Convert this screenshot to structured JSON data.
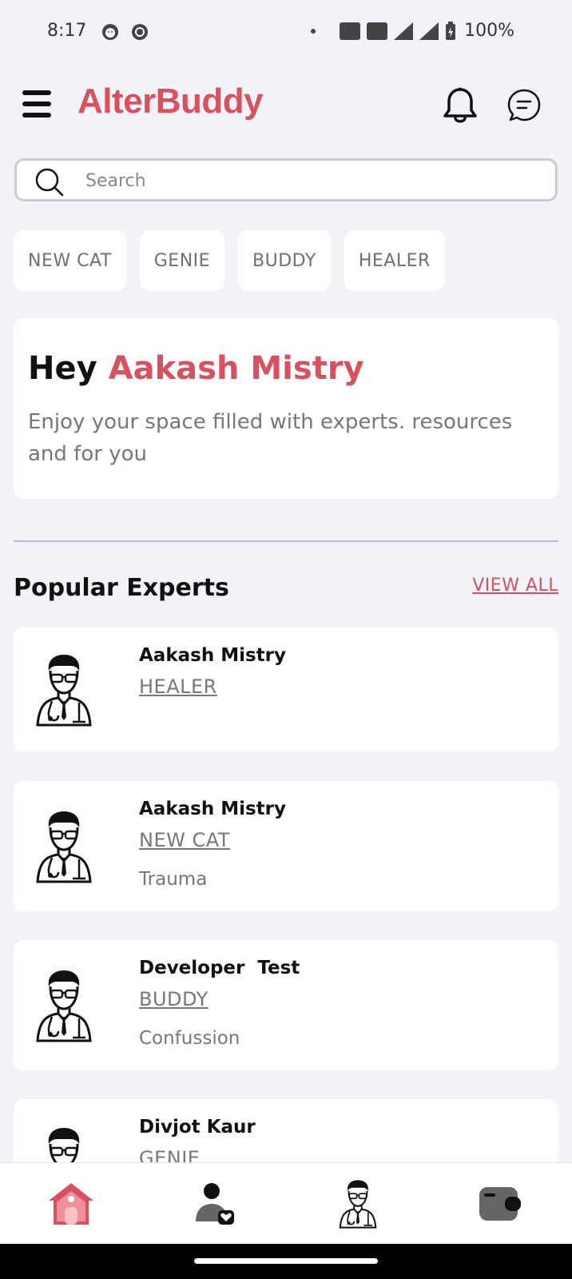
{
  "status_bar": {
    "time": "8:17",
    "battery": "100%"
  },
  "header": {
    "logo_text": "AlterBuddy",
    "menu_icon": "hamburger-icon",
    "bell_icon": "bell-icon",
    "chat_icon": "chat-bubble-icon"
  },
  "search": {
    "placeholder": "Search",
    "value": ""
  },
  "categories": [
    "NEW CAT",
    "GENIE",
    "BUDDY",
    "HEALER"
  ],
  "greeting": {
    "hey": "Hey",
    "name": "Aakash Mistry",
    "subtitle": "Enjoy your space filled with experts. resources and for you"
  },
  "popular": {
    "title": "Popular Experts",
    "view_all": "VIEW ALL",
    "experts": [
      {
        "name": "Aakash Mistry",
        "category": "HEALER",
        "specialty": ""
      },
      {
        "name": "Aakash Mistry",
        "category": "NEW CAT",
        "specialty": "Trauma"
      },
      {
        "name": "Developer  Test",
        "category": "BUDDY",
        "specialty": "Confussion"
      },
      {
        "name": "Divjot Kaur",
        "category": "GENIE",
        "specialty": ""
      }
    ]
  },
  "bottom_nav": {
    "items": [
      "home-icon",
      "profile-heart-icon",
      "doctor-icon",
      "wallet-icon"
    ],
    "active": "home-icon"
  },
  "colors": {
    "brand": "#d9505f",
    "background": "#f1f3f8",
    "card": "#ffffff",
    "muted_text": "#777777"
  }
}
